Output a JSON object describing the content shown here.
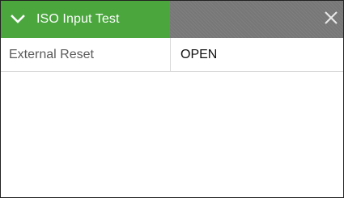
{
  "window": {
    "title": "ISO Input Test",
    "title_color": "#4aa63d",
    "header_bg_color": "#777777",
    "icons": {
      "collapse": "chevron-down-icon",
      "close": "close-icon"
    }
  },
  "rows": [
    {
      "label": "External Reset",
      "value": "OPEN"
    }
  ]
}
